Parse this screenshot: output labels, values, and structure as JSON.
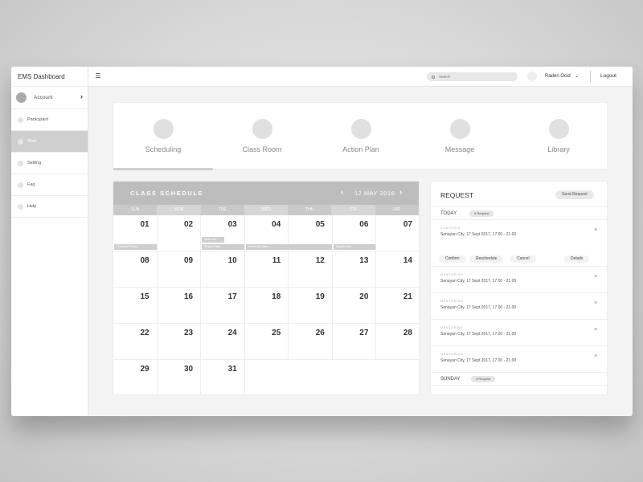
{
  "app": {
    "title": "EMS Dashboard"
  },
  "sidebar": {
    "account_label": "Account",
    "items": [
      {
        "label": "Participant",
        "active": false
      },
      {
        "label": "Start",
        "active": true
      },
      {
        "label": "Setting",
        "active": false
      },
      {
        "label": "Faq",
        "active": false
      },
      {
        "label": "Help",
        "active": false
      }
    ]
  },
  "topbar": {
    "search_placeholder": "Search",
    "user_name": "Raden Ocid",
    "logout_label": "Logout"
  },
  "tabs": [
    {
      "label": "Scheduling",
      "active": true
    },
    {
      "label": "Class Room",
      "active": false
    },
    {
      "label": "Action Plan",
      "active": false
    },
    {
      "label": "Message",
      "active": false
    },
    {
      "label": "Library",
      "active": false
    }
  ],
  "calendar": {
    "title": "CLASS SCHEDULE",
    "current_date": "12 MAY 2016",
    "weekdays": [
      "SUN",
      "MON",
      "TUE",
      "WED",
      "THU",
      "FRI",
      "SAT"
    ],
    "days": [
      "01",
      "02",
      "03",
      "04",
      "05",
      "06",
      "07",
      "08",
      "09",
      "10",
      "11",
      "12",
      "13",
      "14",
      "15",
      "16",
      "17",
      "18",
      "19",
      "20",
      "21",
      "22",
      "23",
      "24",
      "25",
      "26",
      "27",
      "28",
      "29",
      "30",
      "31"
    ],
    "events": [
      {
        "label": "Chemical Protect",
        "day_index": 0,
        "span": 1,
        "slot": 1
      },
      {
        "label": "Math Test",
        "day_index": 2,
        "span": 1,
        "slot": 0
      },
      {
        "label": "Physic Class",
        "day_index": 2,
        "span": 1,
        "slot": 1
      },
      {
        "label": "Chemical Class",
        "day_index": 3,
        "span": 2,
        "slot": 1
      },
      {
        "label": "English Test",
        "day_index": 5,
        "span": 1,
        "slot": 1
      }
    ]
  },
  "request": {
    "title": "REQUEST",
    "send_label": "Send Request",
    "today": {
      "label": "TODAY",
      "badge": "5 Request"
    },
    "items": [
      {
        "category": "COACHING",
        "info": "Senayan City, 17 Sept 2017, 17.00 - 21.00",
        "expanded": true
      },
      {
        "category": "MENTORING",
        "info": "Senayan City, 17 Sept 2017, 17.00 - 21.00",
        "expanded": false
      },
      {
        "category": "MENTORING",
        "info": "Senayan City, 17 Sept 2017, 17.00 - 21.00",
        "expanded": false
      },
      {
        "category": "MENTORING",
        "info": "Senayan City, 17 Sept 2017, 17.00 - 21.00",
        "expanded": false
      },
      {
        "category": "MENTORING",
        "info": "Senayan City, 17 Sept 2017, 17.00 - 21.00",
        "expanded": false
      }
    ],
    "actions": {
      "confirm": "Confirm",
      "reschedule": "Reschedule",
      "cancel": "Cancel",
      "details": "Details"
    },
    "sunday": {
      "label": "SUNDAY",
      "badge": "4 Request"
    }
  },
  "icons": {
    "menu": "hamburger-menu-icon",
    "search": "search-icon",
    "chevron": "chevron-down-icon",
    "prev": "chevron-left-icon",
    "next": "chevron-right-icon"
  }
}
